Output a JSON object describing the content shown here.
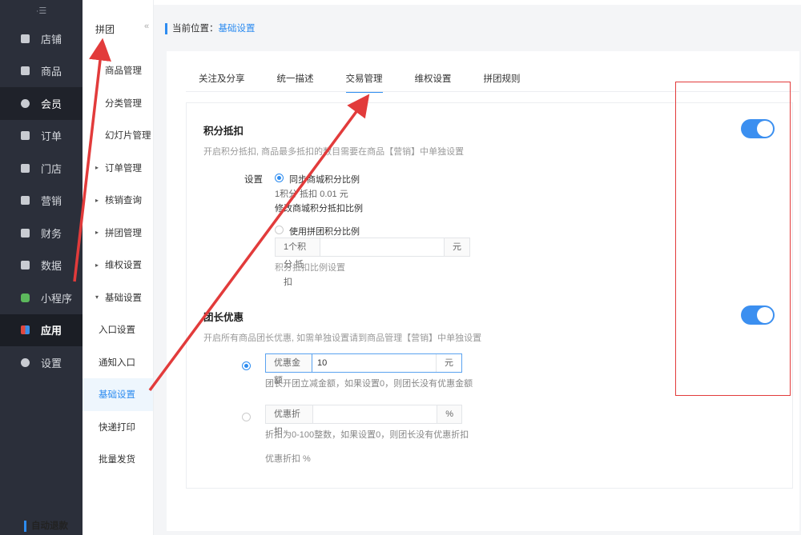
{
  "nav": {
    "collapse_glyph": "·☰",
    "items": [
      {
        "label": "店铺",
        "icon": "store-icon"
      },
      {
        "label": "商品",
        "icon": "goods-icon"
      },
      {
        "label": "会员",
        "icon": "member-icon"
      },
      {
        "label": "订单",
        "icon": "order-icon"
      },
      {
        "label": "门店",
        "icon": "shop-icon"
      },
      {
        "label": "营销",
        "icon": "marketing-icon"
      },
      {
        "label": "财务",
        "icon": "finance-icon"
      },
      {
        "label": "数据",
        "icon": "data-icon"
      },
      {
        "label": "小程序",
        "icon": "miniprogram-icon"
      },
      {
        "label": "应用",
        "icon": "apps-icon"
      },
      {
        "label": "设置",
        "icon": "gear-icon"
      }
    ]
  },
  "subnav": {
    "title": "拼团",
    "collapse_glyph": "«",
    "items": [
      {
        "label": "商品管理",
        "arrow": ""
      },
      {
        "label": "分类管理",
        "arrow": ""
      },
      {
        "label": "幻灯片管理",
        "arrow": ""
      },
      {
        "label": "订单管理",
        "arrow": "▸"
      },
      {
        "label": "核销查询",
        "arrow": "▸"
      },
      {
        "label": "拼团管理",
        "arrow": "▸"
      },
      {
        "label": "维权设置",
        "arrow": "▸"
      },
      {
        "label": "基础设置",
        "arrow": "▾"
      },
      {
        "label": "入口设置",
        "arrow": ""
      },
      {
        "label": "通知入口",
        "arrow": ""
      },
      {
        "label": "基础设置",
        "arrow": ""
      },
      {
        "label": "快递打印",
        "arrow": ""
      },
      {
        "label": "批量发货",
        "arrow": ""
      }
    ]
  },
  "breadcrumb": {
    "prefix": "当前位置：",
    "current": "基础设置"
  },
  "tabs": [
    "关注及分享",
    "统一描述",
    "交易管理",
    "维权设置",
    "拼团规则"
  ],
  "points": {
    "title": "积分抵扣",
    "desc": "开启积分抵扣, 商品最多抵扣的数目需要在商品【营销】中单独设置",
    "setting_label": "设置",
    "opt1": "同步商城积分比例",
    "opt1_rate": "1积分 抵扣 0.01 元",
    "opt1_link": "修改商城积分抵扣比例",
    "opt2": "使用拼团积分比例",
    "opt2_prefix": "1个积分 抵扣",
    "opt2_value": "",
    "opt2_suffix": "元",
    "opt2_help": "积分抵扣比例设置",
    "enabled": true
  },
  "leader": {
    "title": "团长优惠",
    "desc": "开启所有商品团长优惠, 如需单独设置请到商品管理【营销】中单独设置",
    "amount_label": "优惠金额",
    "amount_value": "10",
    "amount_suffix": "元",
    "amount_help": "团长开团立减金额，如果设置0，则团长没有优惠金额",
    "discount_label": "优惠折扣",
    "discount_value": "",
    "discount_suffix": "%",
    "discount_help": "折扣为0-100整数，如果设置0，则团长没有优惠折扣",
    "discount_summary": "优惠折扣 %",
    "enabled": true
  },
  "bottom_section": "自动退款",
  "colors": {
    "accent": "#2d8cf0",
    "toggle": "#3b8ff0",
    "annotation": "#e23b3b",
    "sidebar": "#2b2f3a"
  }
}
